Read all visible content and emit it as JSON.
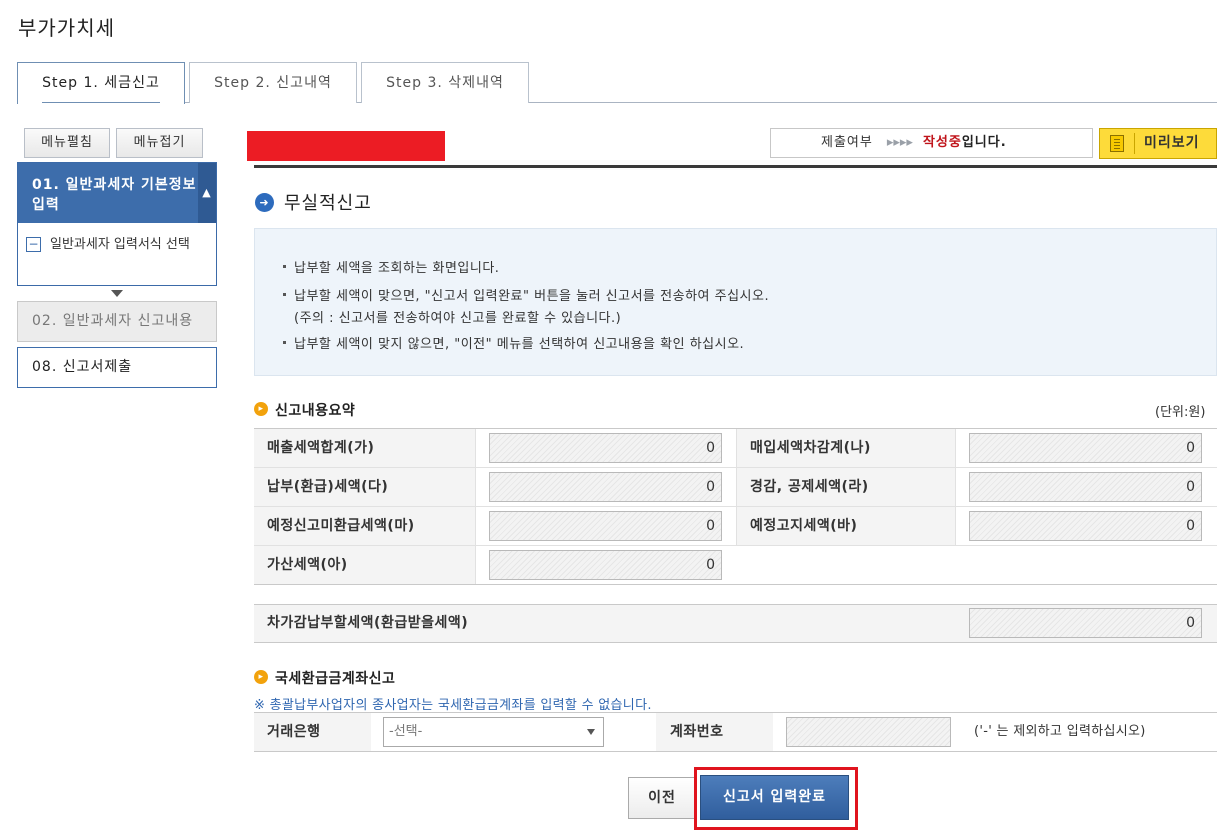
{
  "page": {
    "title": "부가가치세"
  },
  "tabs": [
    {
      "label": "Step 1. 세금신고",
      "active": true
    },
    {
      "label": "Step 2. 신고내역",
      "active": false
    },
    {
      "label": "Step 3. 삭제내역",
      "active": false
    }
  ],
  "sidebar": {
    "expand_label": "메뉴펼침",
    "collapse_label": "메뉴접기",
    "active_item": {
      "label": "01. 일반과세자 기본정보 입력",
      "icon": "chevron-up-icon"
    },
    "sub_item": {
      "label": "일반과세자 입력서식 선택",
      "icon": "minus-box-icon"
    },
    "disabled_item": {
      "label": "02. 일반과세자 신고내용"
    },
    "item_submit": {
      "label": "08. 신고서제출"
    }
  },
  "status": {
    "label": "제출여부",
    "arrows": "▸▸▸▸",
    "value": "작성중",
    "suffix": "입니다.",
    "preview_label": "미리보기",
    "colors": {
      "value": "#c0141b",
      "preview_bg": "#fddb3a",
      "redaction": "#ec1c24"
    }
  },
  "section": {
    "title": "무실적신고",
    "icon": "arrow-right-circle-icon"
  },
  "info": {
    "line1": "납부할 세액을 조회하는 화면입니다.",
    "line2": "납부할 세액이 맞으면, \"신고서 입력완료\" 버튼을 눌러 신고서를 전송하여 주십시오.",
    "line3": "(주의 : 신고서를 전송하여야 신고를 완료할 수 있습니다.)",
    "line4": "납부할 세액이 맞지 않으면, \"이전\" 메뉴를 선택하여 신고내용을 확인 하십시오."
  },
  "summary": {
    "title": "신고내용요약",
    "unit": "(단위:원)",
    "rows": [
      {
        "left_label": "매출세액합계(가)",
        "left_value": "0",
        "right_label": "매입세액차감계(나)",
        "right_value": "0"
      },
      {
        "left_label": "납부(환급)세액(다)",
        "left_value": "0",
        "right_label": "경감, 공제세액(라)",
        "right_value": "0"
      },
      {
        "left_label": "예정신고미환급세액(마)",
        "left_value": "0",
        "right_label": "예정고지세액(바)",
        "right_value": "0"
      },
      {
        "left_label": "가산세액(아)",
        "left_value": "0"
      }
    ],
    "total_label": "차가감납부할세액(환급받을세액)",
    "total_value": "0"
  },
  "refund": {
    "title": "국세환급금계좌신고",
    "note": "※ 총괄납부사업자의 종사업자는 국세환급금계좌를 입력할 수 없습니다.",
    "bank_label": "거래은행",
    "bank_selected": "-선택-",
    "account_label": "계좌번호",
    "account_value": "",
    "account_hint": "('-' 는 제외하고 입력하십시오)"
  },
  "actions": {
    "prev_label": "이전",
    "submit_label": "신고서 입력완료"
  }
}
